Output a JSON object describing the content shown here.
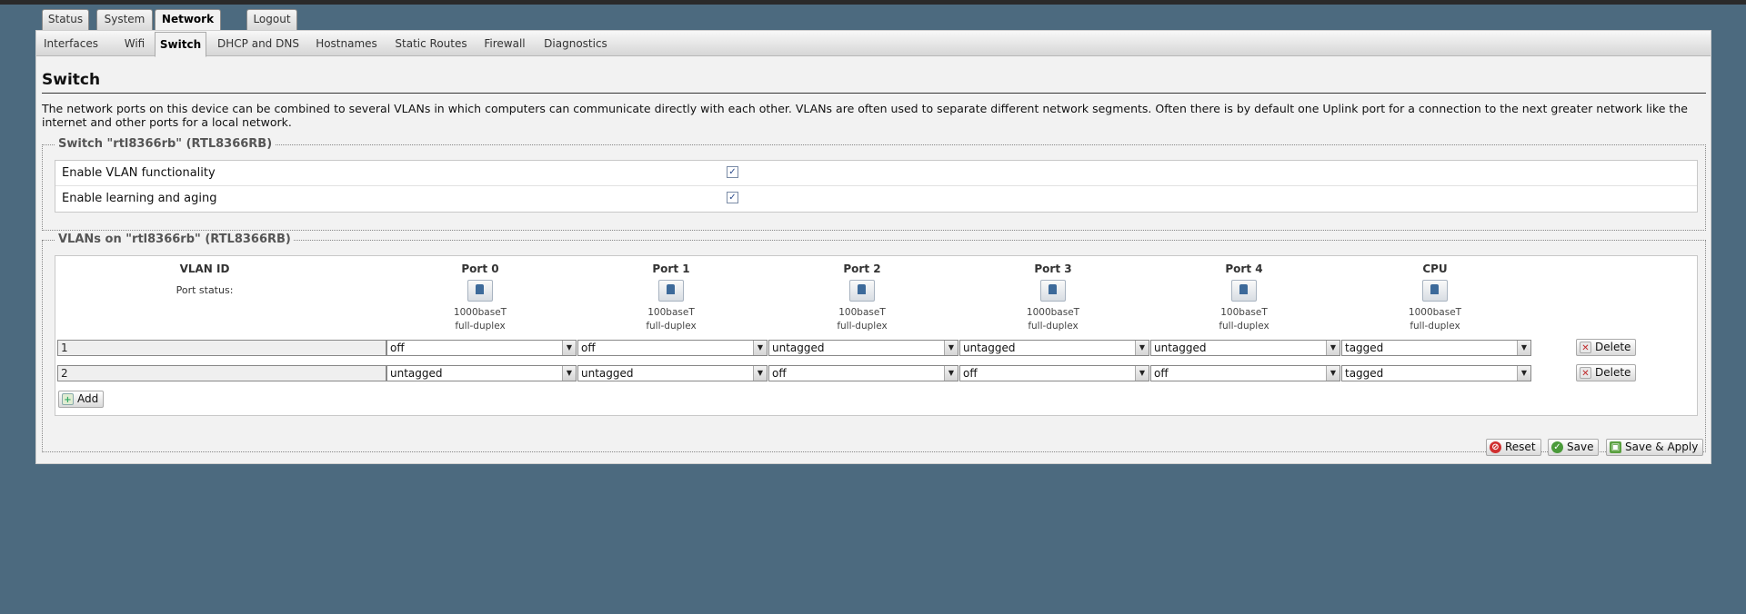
{
  "main_tabs": [
    "Status",
    "System",
    "Network",
    "Logout"
  ],
  "sub_tabs": [
    "Interfaces",
    "Wifi",
    "Switch",
    "DHCP and DNS",
    "Hostnames",
    "Static Routes",
    "Firewall",
    "Diagnostics"
  ],
  "page": {
    "title": "Switch",
    "description": "The network ports on this device can be combined to several VLANs in which computers can communicate directly with each other. VLANs are often used to separate different network segments. Often there is by default one Uplink port for a connection to the next greater network like the internet and other ports for a local network."
  },
  "switch_section": {
    "legend": "Switch \"rtl8366rb\" (RTL8366RB)",
    "options": [
      {
        "label": "Enable VLAN functionality",
        "checked": true
      },
      {
        "label": "Enable learning and aging",
        "checked": true
      }
    ]
  },
  "vlans_section": {
    "legend": "VLANs on \"rtl8366rb\" (RTL8366RB)",
    "vlan_id_header": "VLAN ID",
    "port_status_label": "Port status:",
    "ports": [
      {
        "name": "Port 0",
        "speed": "1000baseT",
        "duplex": "full-duplex"
      },
      {
        "name": "Port 1",
        "speed": "100baseT",
        "duplex": "full-duplex"
      },
      {
        "name": "Port 2",
        "speed": "100baseT",
        "duplex": "full-duplex"
      },
      {
        "name": "Port 3",
        "speed": "1000baseT",
        "duplex": "full-duplex"
      },
      {
        "name": "Port 4",
        "speed": "100baseT",
        "duplex": "full-duplex"
      },
      {
        "name": "CPU",
        "speed": "1000baseT",
        "duplex": "full-duplex"
      }
    ],
    "rows": [
      {
        "vlan_id": "1",
        "values": [
          "off",
          "off",
          "untagged",
          "untagged",
          "untagged",
          "tagged"
        ],
        "delete_label": "Delete"
      },
      {
        "vlan_id": "2",
        "values": [
          "untagged",
          "untagged",
          "off",
          "off",
          "off",
          "tagged"
        ],
        "delete_label": "Delete"
      }
    ],
    "add_label": "Add"
  },
  "footer": {
    "reset_label": "Reset",
    "save_label": "Save",
    "save_apply_label": "Save & Apply"
  }
}
